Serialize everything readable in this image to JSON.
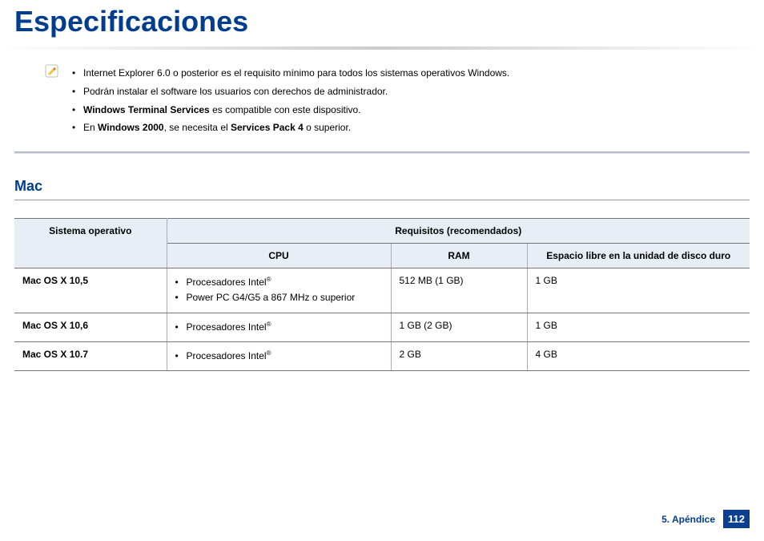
{
  "title": "Especificaciones",
  "notes": {
    "items": [
      {
        "prefix": "",
        "bold": "",
        "mid": "Internet Explorer 6.0 o posterior es el requisito mínimo para todos los sistemas operativos Windows.",
        "bold2": "",
        "suffix": ""
      },
      {
        "prefix": "",
        "bold": "",
        "mid": "Podrán instalar el software los usuarios con derechos de administrador.",
        "bold2": "",
        "suffix": ""
      },
      {
        "prefix": "",
        "bold": "Windows Terminal Services",
        "mid": " es compatible con este dispositivo.",
        "bold2": "",
        "suffix": ""
      },
      {
        "prefix": "En ",
        "bold": "Windows 2000",
        "mid": ", se necesita el ",
        "bold2": "Services Pack 4",
        "suffix": " o superior."
      }
    ]
  },
  "section": {
    "heading": "Mac",
    "table": {
      "col_os": "Sistema operativo",
      "col_req": "Requisitos (recomendados)",
      "col_cpu": "CPU",
      "col_ram": "RAM",
      "col_disk": "Espacio libre en la unidad de disco duro",
      "rows": [
        {
          "os": "Mac OS X 10,5",
          "cpu": [
            "Procesadores Intel",
            "Power PC G4/G5 a 867 MHz o superior"
          ],
          "cpu_reg": [
            true,
            false
          ],
          "ram": "512 MB (1 GB)",
          "disk": "1 GB"
        },
        {
          "os": "Mac OS X 10,6",
          "cpu": [
            "Procesadores Intel"
          ],
          "cpu_reg": [
            true
          ],
          "ram": "1 GB (2 GB)",
          "disk": "1 GB"
        },
        {
          "os": "Mac OS X 10.7",
          "cpu": [
            "Procesadores Intel"
          ],
          "cpu_reg": [
            true
          ],
          "ram": "2 GB",
          "disk": "4 GB"
        }
      ]
    }
  },
  "footer": {
    "section_label": "5. Apéndice",
    "page": "112"
  },
  "colors": {
    "brand_blue": "#003d8f",
    "page_badge": "#0a3f91",
    "header_bg": "#e7eef5"
  }
}
